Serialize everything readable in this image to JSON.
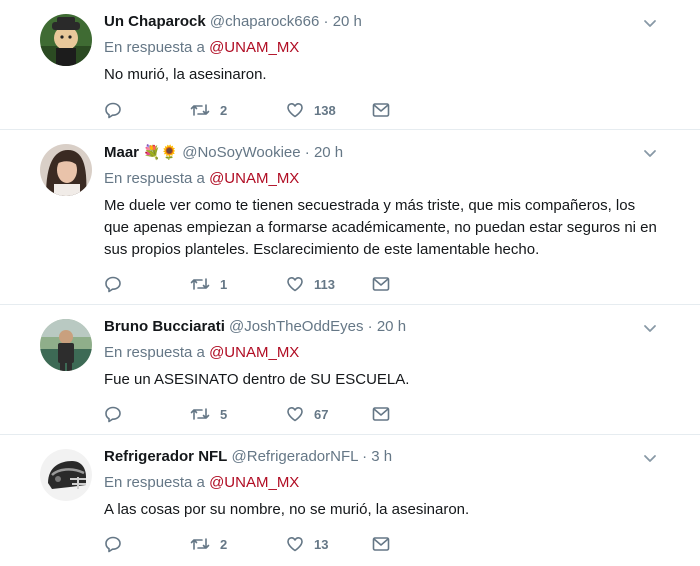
{
  "reply_prefix": "En respuesta a",
  "tweets": [
    {
      "name": "Un Chaparock",
      "name_emoji": "",
      "handle": "@chaparock666",
      "time": "20 h",
      "reply_to": "@UNAM_MX",
      "text": "No murió, la asesinaron.",
      "replies": "",
      "retweets": "2",
      "likes": "138"
    },
    {
      "name": "Maar",
      "name_emoji": "💐🌻",
      "handle": "@NoSoyWookiee",
      "time": "20 h",
      "reply_to": "@UNAM_MX",
      "text": "Me duele ver como te tienen secuestrada y más triste, que mis compañeros, los que apenas empiezan a formarse académicamente, no puedan estar seguros ni en sus propios planteles. Esclarecimiento de este lamentable hecho.",
      "replies": "",
      "retweets": "1",
      "likes": "113"
    },
    {
      "name": "Bruno Bucciarati",
      "name_emoji": "",
      "handle": "@JoshTheOddEyes",
      "time": "20 h",
      "reply_to": "@UNAM_MX",
      "text": "Fue un ASESINATO dentro de SU ESCUELA.",
      "replies": "",
      "retweets": "5",
      "likes": "67"
    },
    {
      "name": "Refrigerador NFL",
      "name_emoji": "",
      "handle": "@RefrigeradorNFL",
      "time": "3 h",
      "reply_to": "@UNAM_MX",
      "text": "A las cosas por su nombre, no se murió, la asesinaron.",
      "replies": "",
      "retweets": "2",
      "likes": "13"
    }
  ],
  "icons": {
    "reply": "reply-icon",
    "retweet": "retweet-icon",
    "like": "heart-icon",
    "dm": "envelope-icon",
    "menu": "chevron-down-icon"
  },
  "colors": {
    "mention": "#b00c23",
    "secondary_text": "#657786",
    "divider": "#e6ecf0"
  }
}
